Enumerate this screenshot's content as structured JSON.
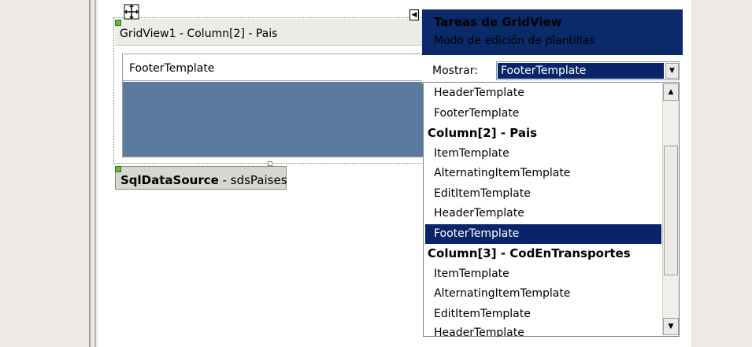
{
  "gridview": {
    "title": "GridView1 - Column[2] - Pais",
    "footer_label": "FooterTemplate",
    "move_icon": "move-arrows-icon"
  },
  "datasource": {
    "type_label": "SqlDataSource",
    "separator": " - ",
    "id_label": "sdsPaises"
  },
  "smart_tag": {
    "title": "Tareas de GridView",
    "subtitle": "Modo de edición de plantillas",
    "show_label": "Mostrar:",
    "selected_value": "FooterTemplate"
  },
  "dropdown": {
    "items": [
      {
        "label": "HeaderTemplate",
        "kind": "item"
      },
      {
        "label": "FooterTemplate",
        "kind": "item"
      },
      {
        "label": "Column[2] - Pais",
        "kind": "group"
      },
      {
        "label": "ItemTemplate",
        "kind": "item"
      },
      {
        "label": "AlternatingItemTemplate",
        "kind": "item"
      },
      {
        "label": "EditItemTemplate",
        "kind": "item"
      },
      {
        "label": "HeaderTemplate",
        "kind": "item"
      },
      {
        "label": "FooterTemplate",
        "kind": "item",
        "selected": true
      },
      {
        "label": "Column[3] - CodEnTransportes",
        "kind": "group"
      },
      {
        "label": "ItemTemplate",
        "kind": "item"
      },
      {
        "label": "AlternatingItemTemplate",
        "kind": "item"
      },
      {
        "label": "EditItemTemplate",
        "kind": "item"
      },
      {
        "label": "HeaderTemplate",
        "kind": "item"
      }
    ]
  },
  "colors": {
    "selection": "#0a246a",
    "footer_body": "#5a7a9e",
    "panel_header": "#0a2a6a"
  }
}
